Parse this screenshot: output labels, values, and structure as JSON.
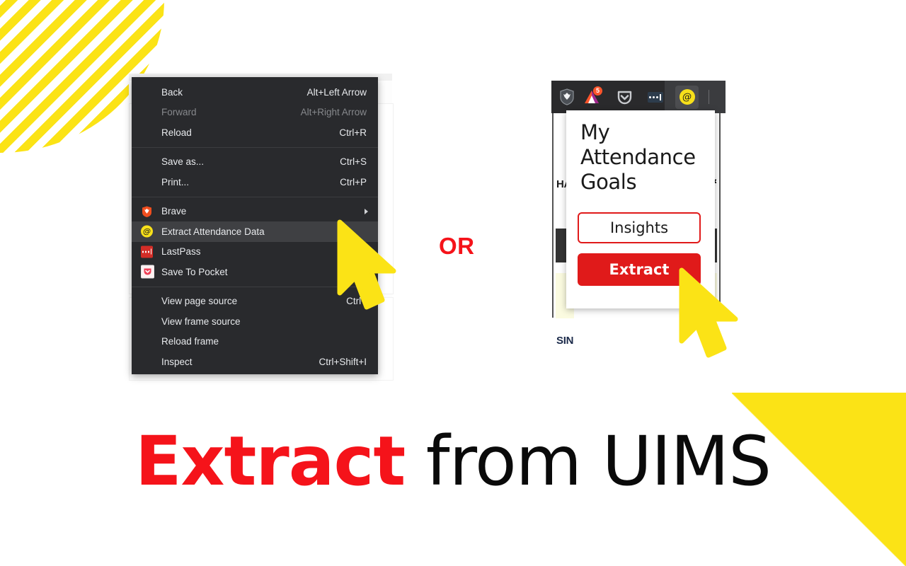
{
  "decor": {
    "stripe_color": "#fbe316",
    "triangle_color": "#fbe316"
  },
  "context_menu": {
    "name": "browser-context-menu",
    "background": "#292a2d",
    "highlight_color": "#3f4043",
    "groups": [
      {
        "items": [
          {
            "label": "Back",
            "accel": "Alt+Left Arrow",
            "disabled": false,
            "icon": null,
            "submenu": false,
            "highlight": false
          },
          {
            "label": "Forward",
            "accel": "Alt+Right Arrow",
            "disabled": true,
            "icon": null,
            "submenu": false,
            "highlight": false
          },
          {
            "label": "Reload",
            "accel": "Ctrl+R",
            "disabled": false,
            "icon": null,
            "submenu": false,
            "highlight": false
          }
        ]
      },
      {
        "items": [
          {
            "label": "Save as...",
            "accel": "Ctrl+S",
            "disabled": false,
            "icon": null,
            "submenu": false,
            "highlight": false
          },
          {
            "label": "Print...",
            "accel": "Ctrl+P",
            "disabled": false,
            "icon": null,
            "submenu": false,
            "highlight": false
          }
        ]
      },
      {
        "items": [
          {
            "label": "Brave",
            "accel": "",
            "disabled": false,
            "icon": "brave-lion-icon",
            "submenu": true,
            "highlight": false
          },
          {
            "label": "Extract Attendance Data",
            "accel": "",
            "disabled": false,
            "icon": "extract-attendance-extension-icon",
            "submenu": false,
            "highlight": true
          },
          {
            "label": "LastPass",
            "accel": "",
            "disabled": false,
            "icon": "lastpass-icon",
            "submenu": false,
            "highlight": false
          },
          {
            "label": "Save To Pocket",
            "accel": "",
            "disabled": false,
            "icon": "pocket-icon",
            "submenu": false,
            "highlight": false
          }
        ]
      },
      {
        "items": [
          {
            "label": "View page source",
            "accel": "Ctrl+",
            "disabled": false,
            "icon": null,
            "submenu": false,
            "highlight": false
          },
          {
            "label": "View frame source",
            "accel": "",
            "disabled": false,
            "icon": null,
            "submenu": false,
            "highlight": false
          },
          {
            "label": "Reload frame",
            "accel": "",
            "disabled": false,
            "icon": null,
            "submenu": false,
            "highlight": false
          },
          {
            "label": "Inspect",
            "accel": "Ctrl+Shift+I",
            "disabled": false,
            "icon": null,
            "submenu": false,
            "highlight": false
          }
        ]
      }
    ]
  },
  "divider": {
    "or_label": "OR"
  },
  "browser": {
    "toolbar": {
      "name": "browser-toolbar",
      "background": "#2a2a2c",
      "buttons": [
        {
          "name": "brave-shield-icon",
          "label": "",
          "badge": ""
        },
        {
          "name": "brave-rewards-icon",
          "label": "",
          "badge": "5"
        },
        {
          "name": "pocket-icon",
          "label": "",
          "badge": ""
        },
        {
          "name": "lastpass-icon",
          "label": "",
          "badge": ""
        },
        {
          "name": "extract-attendance-extension-icon",
          "label": "@",
          "badge": ""
        }
      ]
    },
    "page_behind": {
      "text_left": "HA",
      "text_bottom": "SIN",
      "gear_glyph": "⚙",
      "dark_bar_color": "#333333",
      "cream_color": "#fbfbe0"
    },
    "popup": {
      "name": "extension-popup",
      "title": "My Attendance Goals",
      "insights_label": "Insights",
      "extract_label": "Extract",
      "accent_color": "#e01a1a"
    }
  },
  "headline": {
    "highlight": "Extract",
    "rest": " from UIMS",
    "highlight_color": "#f5131a",
    "rest_color": "#0a0a0a"
  },
  "cursors": [
    {
      "name": "pointer-cursor-menu",
      "color": "#fbe316"
    },
    {
      "name": "pointer-cursor-popup",
      "color": "#fbe316"
    }
  ]
}
